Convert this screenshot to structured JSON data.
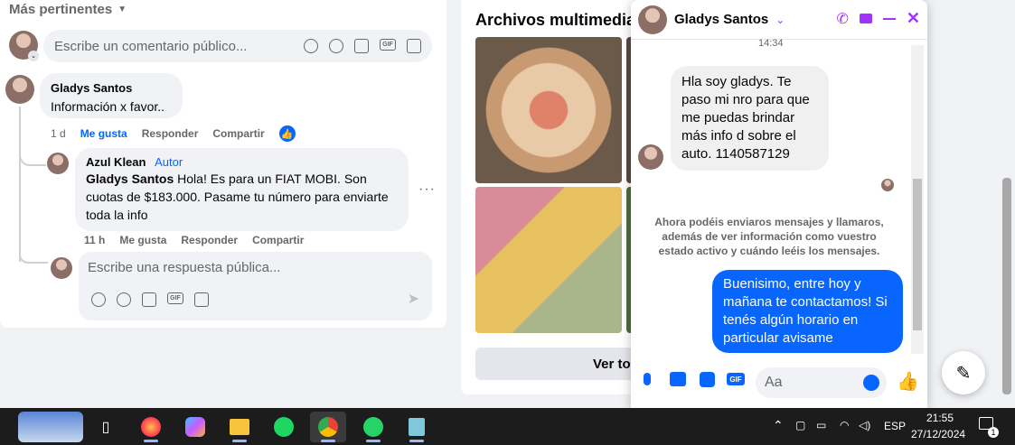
{
  "post": {
    "sort_label": "Más pertinentes",
    "comment_placeholder": "Escribe un comentario público...",
    "comment": {
      "author": "Gladys Santos",
      "text": "Información x favor..",
      "time": "1 d",
      "like": "Me gusta",
      "reply": "Responder",
      "share": "Compartir"
    },
    "reply": {
      "author": "Azul Klean",
      "author_badge": "Autor",
      "mention": "Gladys Santos",
      "text": " Hola! Es para un FIAT MOBI. Son cuotas de $183.000. Pasame tu número para enviarte toda la info",
      "time": "11 h",
      "like": "Me gusta",
      "reply": "Responder",
      "share": "Compartir"
    },
    "reply_placeholder": "Escribe una respuesta pública..."
  },
  "media": {
    "title": "Archivos multimedia re",
    "see_all": "Ver to"
  },
  "chat": {
    "contact_name": "Gladys Santos",
    "timestamp": "14:34",
    "incoming_message": "Hla soy gladys. Te paso mi nro para que me puedas brindar más info d sobre el auto. 1140587129",
    "system_note": "Ahora podéis enviaros mensajes y llamaros, además de ver información como vuestro estado activo y cuándo leéis los mensajes.",
    "outgoing_message": "Buenisimo, entre hoy y mañana te contactamos! Si tenés algún horario en particular avisame",
    "input_placeholder": "Aa",
    "accent_color": "#a033ff",
    "bubble_color": "#0866ff"
  },
  "taskbar": {
    "language": "ESP",
    "time": "21:55",
    "date": "27/12/2024",
    "notification_count": "1"
  }
}
